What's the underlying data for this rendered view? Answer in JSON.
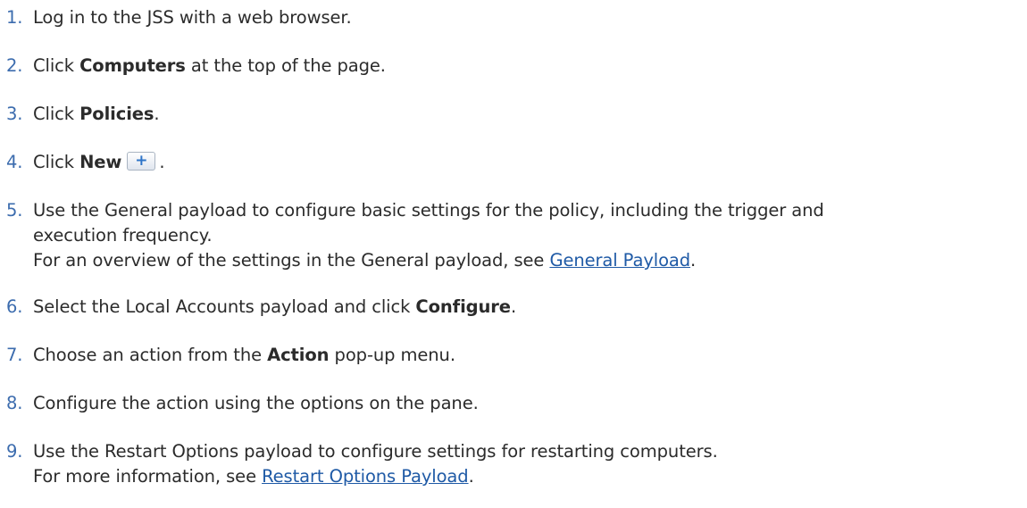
{
  "steps": [
    {
      "num": "1.",
      "parts": [
        "Log in to the JSS with a web browser."
      ]
    },
    {
      "num": "2.",
      "pre": "Click ",
      "bold": "Computers",
      "post": " at the top of the page."
    },
    {
      "num": "3.",
      "pre": "Click ",
      "bold": "Policies",
      "post": "."
    },
    {
      "num": "4.",
      "pre": "Click ",
      "bold": "New",
      "post": "."
    },
    {
      "num": "5.",
      "line1": "Use the General payload to configure basic settings for the policy, including the trigger and",
      "line2": "execution frequency.",
      "line3_pre": "For an overview of the settings in the General payload, see ",
      "line3_link": "General Payload",
      "line3_post": "."
    },
    {
      "num": "6.",
      "pre": "Select the Local Accounts payload and click ",
      "bold": "Configure",
      "post": "."
    },
    {
      "num": "7.",
      "pre": "Choose an action from the ",
      "bold": "Action",
      "post": " pop-up menu."
    },
    {
      "num": "8.",
      "parts": [
        "Configure the action using the options on the pane."
      ]
    },
    {
      "num": "9.",
      "line1": "Use the Restart Options payload to configure settings for restarting computers.",
      "line2_pre": "For more information, see ",
      "line2_link": "Restart Options Payload",
      "line2_post": "."
    }
  ],
  "icons": {
    "new_button_icon": "plus-icon",
    "new_button_glyph": "+"
  }
}
